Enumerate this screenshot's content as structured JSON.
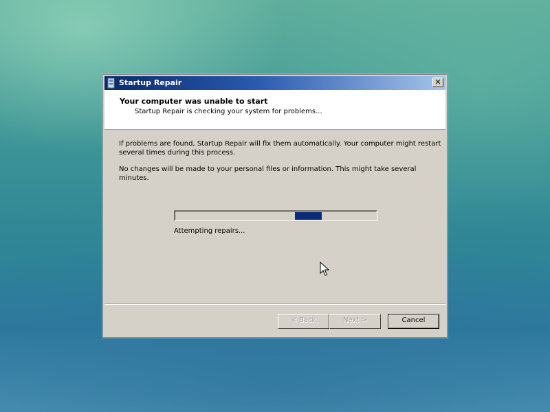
{
  "window": {
    "title": "Startup Repair",
    "close_glyph": "✕"
  },
  "header": {
    "title": "Your computer was unable to start",
    "subtitle": "Startup Repair is checking your system for problems..."
  },
  "body": {
    "paragraph1": "If problems are found, Startup Repair will fix them automatically. Your computer might restart several times during this process.",
    "paragraph2": "No changes will be made to your personal files or information. This might take several minutes.",
    "progress_style": "marquee",
    "status": "Attempting repairs..."
  },
  "buttons": {
    "back": "< Back",
    "next": "Next >",
    "cancel": "Cancel"
  },
  "colors": {
    "titlebar_start": "#0a2a6b",
    "titlebar_end": "#a7c4ea",
    "progress_block": "#0c2a78",
    "dialog_bg": "#d5d1c8"
  },
  "icons": {
    "title_icon": "startup-repair-icon",
    "close": "close-icon",
    "cursor": "mouse-pointer-icon"
  }
}
